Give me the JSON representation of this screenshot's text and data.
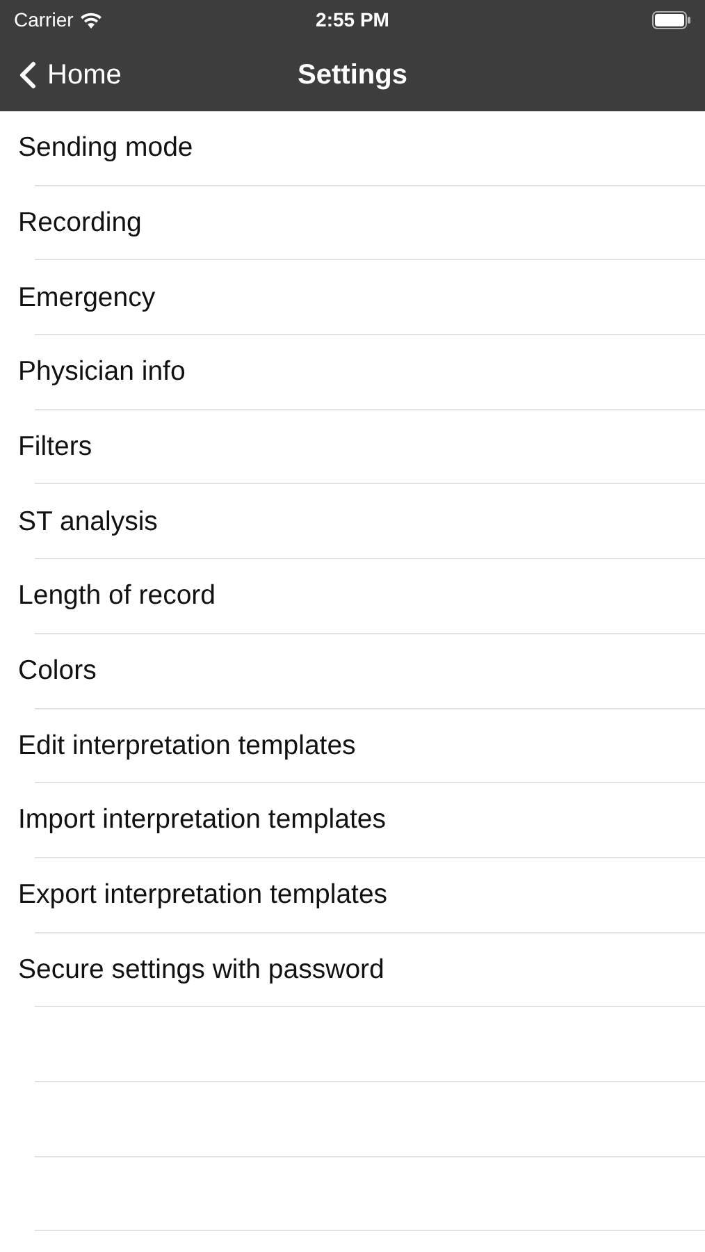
{
  "status_bar": {
    "carrier": "Carrier",
    "time": "2:55 PM"
  },
  "nav_bar": {
    "back_label": "Home",
    "title": "Settings"
  },
  "items": [
    {
      "label": "Sending mode"
    },
    {
      "label": "Recording"
    },
    {
      "label": "Emergency"
    },
    {
      "label": "Physician info"
    },
    {
      "label": "Filters"
    },
    {
      "label": "ST analysis"
    },
    {
      "label": "Length of record"
    },
    {
      "label": "Colors"
    },
    {
      "label": "Edit interpretation templates"
    },
    {
      "label": "Import interpretation templates"
    },
    {
      "label": "Export interpretation templates"
    },
    {
      "label": "Secure settings with password"
    }
  ]
}
